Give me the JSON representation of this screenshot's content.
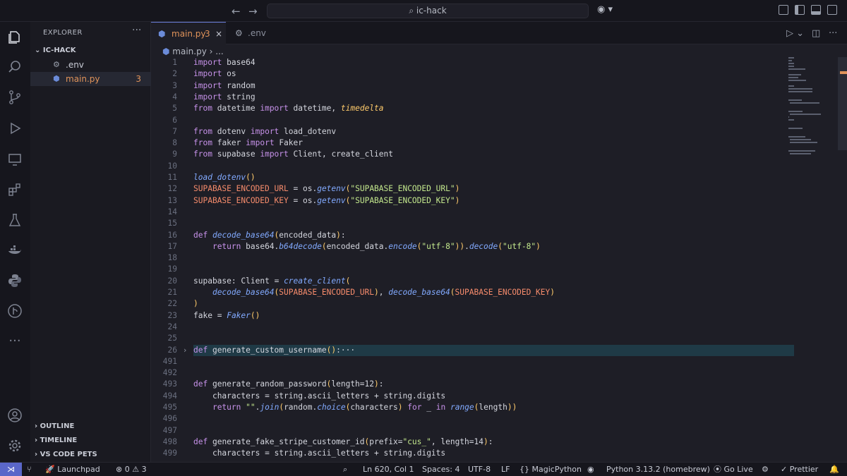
{
  "titlebar": {
    "search_text": "ic-hack"
  },
  "sidebar": {
    "title": "EXPLORER",
    "folder": "IC-HACK",
    "files": [
      {
        "name": ".env",
        "badge": ""
      },
      {
        "name": "main.py",
        "badge": "3"
      }
    ],
    "sections": [
      "OUTLINE",
      "TIMELINE",
      "VS CODE PETS"
    ]
  },
  "tabs": [
    {
      "label": "main.py",
      "badge": "3",
      "active": true
    },
    {
      "label": ".env",
      "badge": "",
      "active": false
    }
  ],
  "breadcrumb": {
    "file": "main.py",
    "rest": "..."
  },
  "editor": {
    "lines": [
      {
        "n": "1",
        "text": "import base64"
      },
      {
        "n": "2",
        "text": "import os"
      },
      {
        "n": "3",
        "text": "import random"
      },
      {
        "n": "4",
        "text": "import string"
      },
      {
        "n": "5",
        "text": "from datetime import datetime, timedelta"
      },
      {
        "n": "6",
        "text": ""
      },
      {
        "n": "7",
        "text": "from dotenv import load_dotenv"
      },
      {
        "n": "8",
        "text": "from faker import Faker"
      },
      {
        "n": "9",
        "text": "from supabase import Client, create_client"
      },
      {
        "n": "10",
        "text": ""
      },
      {
        "n": "11",
        "text": "load_dotenv()"
      },
      {
        "n": "12",
        "text": "SUPABASE_ENCODED_URL = os.getenv(\"SUPABASE_ENCODED_URL\")"
      },
      {
        "n": "13",
        "text": "SUPABASE_ENCODED_KEY = os.getenv(\"SUPABASE_ENCODED_KEY\")"
      },
      {
        "n": "14",
        "text": ""
      },
      {
        "n": "15",
        "text": ""
      },
      {
        "n": "16",
        "text": "def decode_base64(encoded_data):"
      },
      {
        "n": "17",
        "text": "    return base64.b64decode(encoded_data.encode(\"utf-8\")).decode(\"utf-8\")"
      },
      {
        "n": "18",
        "text": ""
      },
      {
        "n": "19",
        "text": ""
      },
      {
        "n": "20",
        "text": "supabase: Client = create_client("
      },
      {
        "n": "21",
        "text": "    decode_base64(SUPABASE_ENCODED_URL), decode_base64(SUPABASE_ENCODED_KEY)"
      },
      {
        "n": "22",
        "text": ")"
      },
      {
        "n": "23",
        "text": "fake = Faker()"
      },
      {
        "n": "24",
        "text": ""
      },
      {
        "n": "25",
        "text": ""
      },
      {
        "n": "26",
        "text": "def generate_custom_username():···"
      },
      {
        "n": "491",
        "text": ""
      },
      {
        "n": "492",
        "text": ""
      },
      {
        "n": "493",
        "text": "def generate_random_password(length=12):"
      },
      {
        "n": "494",
        "text": "    characters = string.ascii_letters + string.digits"
      },
      {
        "n": "495",
        "text": "    return \"\".join(random.choice(characters) for _ in range(length))"
      },
      {
        "n": "496",
        "text": ""
      },
      {
        "n": "497",
        "text": ""
      },
      {
        "n": "498",
        "text": "def generate_fake_stripe_customer_id(prefix=\"cus_\", length=14):"
      },
      {
        "n": "499",
        "text": "    characters = string.ascii_letters + string.digits"
      }
    ]
  },
  "status": {
    "launchpad": "Launchpad",
    "errors": "0",
    "warnings": "3",
    "position": "Ln 620, Col 1",
    "spaces": "Spaces: 4",
    "encoding": "UTF-8",
    "eol": "LF",
    "language": "MagicPython",
    "interpreter": "Python 3.13.2 (homebrew)",
    "golive": "Go Live",
    "prettier": "Prettier"
  }
}
